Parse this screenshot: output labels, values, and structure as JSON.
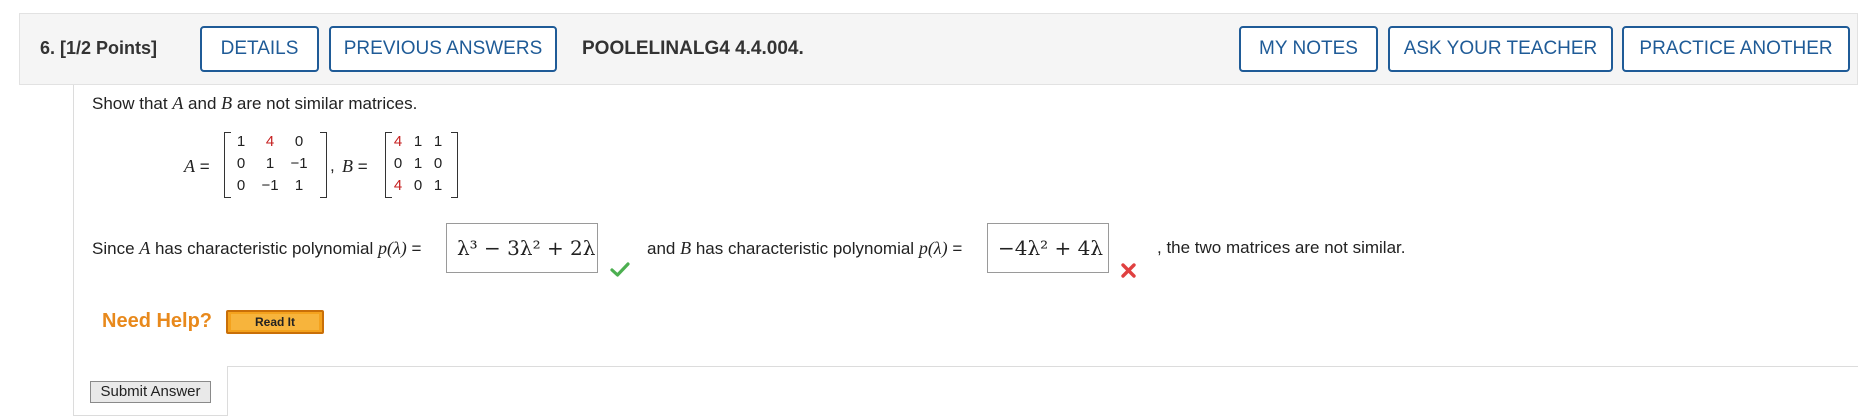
{
  "header": {
    "question_points": "6.  [1/2 Points]",
    "details_label": "DETAILS",
    "previous_answers_label": "PREVIOUS ANSWERS",
    "question_id": "POOLELINALG4 4.4.004.",
    "my_notes_label": "MY NOTES",
    "ask_teacher_label": "ASK YOUR TEACHER",
    "practice_another_label": "PRACTICE ANOTHER"
  },
  "problem": {
    "intro_pre": "Show that ",
    "var_a": "A",
    "intro_mid": " and ",
    "var_b": "B",
    "intro_post": " are not similar matrices.",
    "a_label": "=",
    "b_label": "=",
    "separator": ",",
    "matrix_a": [
      [
        "1",
        "4",
        "0"
      ],
      [
        "0",
        "1",
        "−1"
      ],
      [
        "0",
        "−1",
        "1"
      ]
    ],
    "matrix_b": [
      [
        "4",
        "1",
        "1"
      ],
      [
        "0",
        "1",
        "0"
      ],
      [
        "4",
        "0",
        "1"
      ]
    ]
  },
  "answer": {
    "since_pre": "Since ",
    "since_var": "A",
    "since_post": " has characteristic polynomial ",
    "p_lambda": "p(λ)",
    "eq": " =",
    "answer_a": "λ³ − 3λ² + 2λ",
    "and_pre": "and ",
    "and_var": "B",
    "and_post": " has characteristic polynomial ",
    "answer_b": "−4λ² + 4λ",
    "conclusion": ", the two matrices are not similar.",
    "status_a": "correct",
    "status_b": "incorrect"
  },
  "help": {
    "need_help_label": "Need Help?",
    "read_it_label": "Read It"
  },
  "submit_label": "Submit Answer",
  "colors": {
    "accent": "#1f5b97",
    "need_help": "#e8891c",
    "correct": "#4caf50",
    "incorrect": "#e04040",
    "highlight_entry": "#c62020"
  }
}
